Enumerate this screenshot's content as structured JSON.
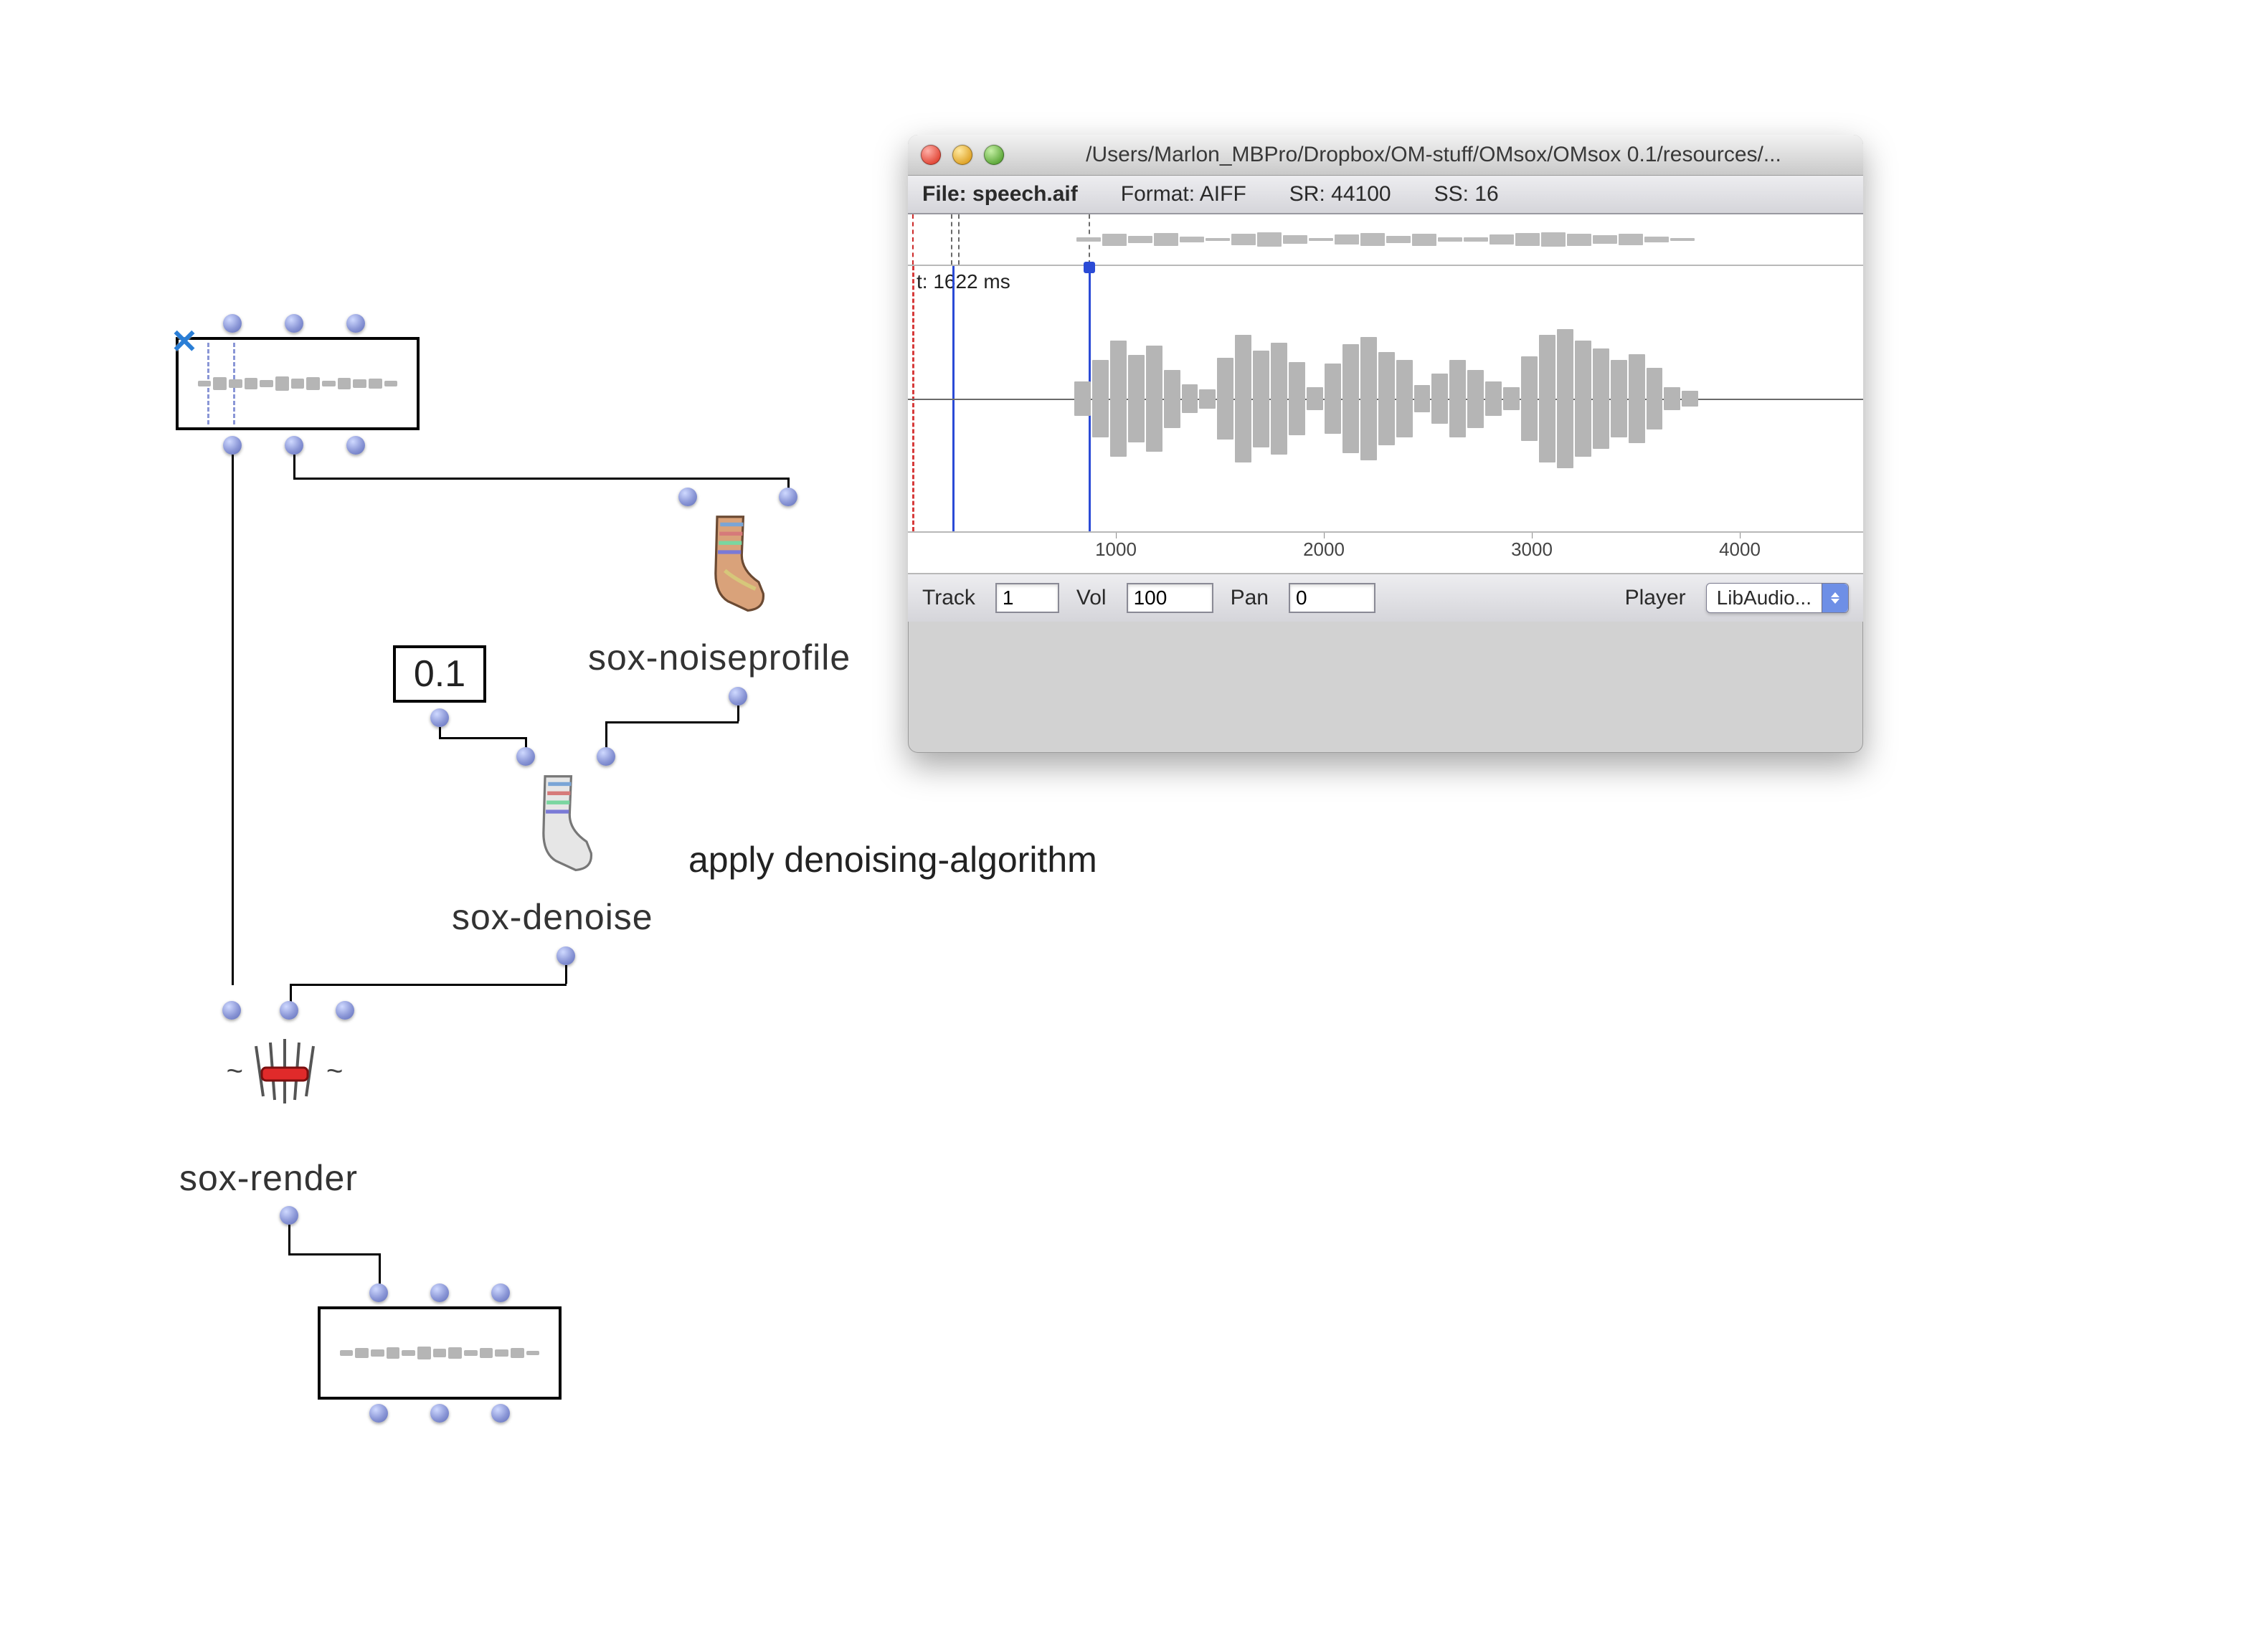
{
  "patch": {
    "numbox_value": "0.1",
    "module_noiseprofile": "sox-noiseprofile",
    "module_denoise": "sox-denoise",
    "module_render": "sox-render",
    "annotation": "apply denoising-algorithm"
  },
  "window": {
    "title": "/Users/Marlon_MBPro/Dropbox/OM-stuff/OMsox/OMsox 0.1/resources/...",
    "info": {
      "file_label": "File:",
      "file_name": "speech.aif",
      "format_label": "Format:",
      "format_value": "AIFF",
      "sr_label": "SR:",
      "sr_value": "44100",
      "ss_label": "SS:",
      "ss_value": "16"
    },
    "detail": {
      "t_label": "t: 1622 ms"
    },
    "ruler": {
      "ticks": [
        "1000",
        "2000",
        "3000",
        "4000"
      ]
    },
    "controls": {
      "track_label": "Track",
      "track_value": "1",
      "vol_label": "Vol",
      "vol_value": "100",
      "pan_label": "Pan",
      "pan_value": "0",
      "player_label": "Player",
      "player_value": "LibAudio..."
    }
  }
}
